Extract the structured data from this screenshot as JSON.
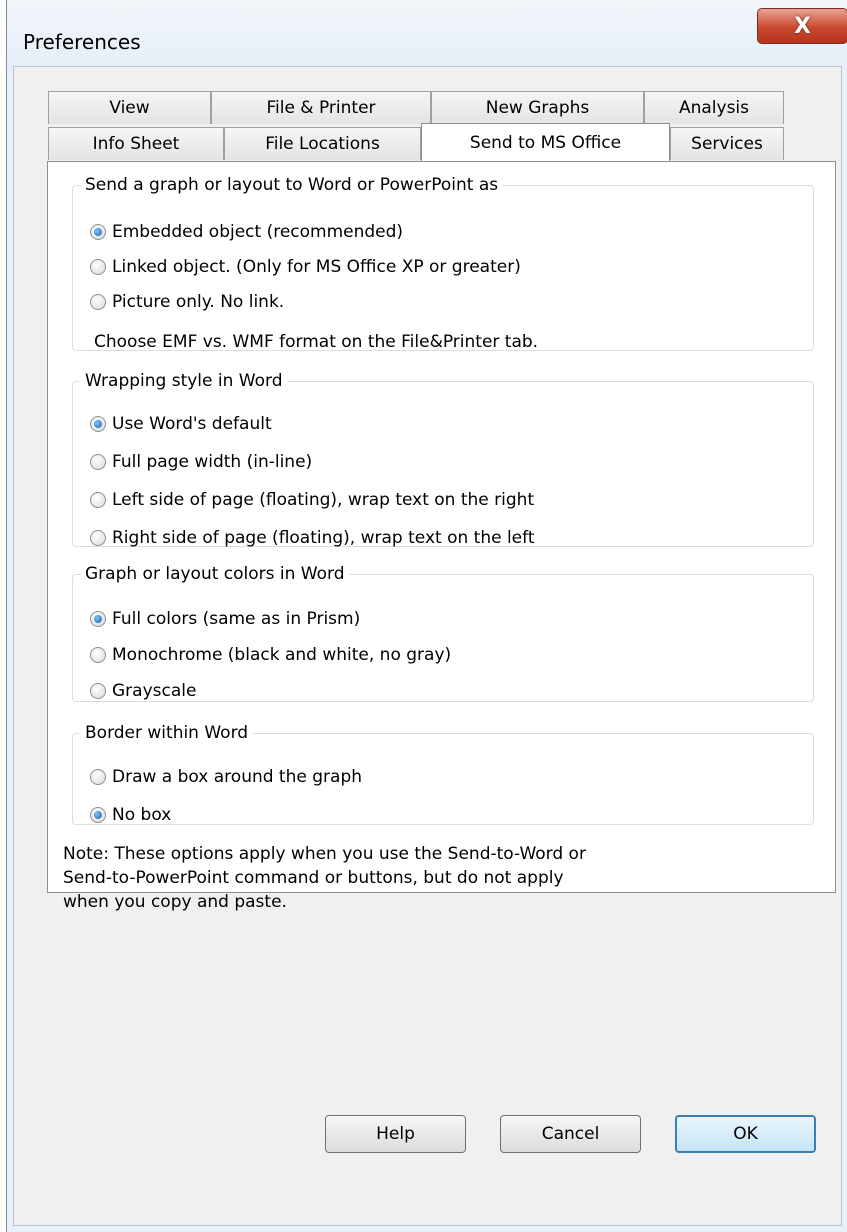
{
  "window": {
    "title": "Preferences",
    "close_glyph": "X"
  },
  "tabs": {
    "row1": [
      "View",
      "File & Printer",
      "New Graphs",
      "Analysis"
    ],
    "row2": [
      "Info Sheet",
      "File Locations",
      "Send to MS Office",
      "Services"
    ],
    "active": "Send to MS Office"
  },
  "send_as": {
    "legend": "Send a graph or layout to Word or PowerPoint as",
    "options": [
      {
        "label": "Embedded object (recommended)",
        "checked": true
      },
      {
        "label": "Linked object. (Only for MS Office XP or greater)",
        "checked": false
      },
      {
        "label": "Picture only. No link.",
        "checked": false
      }
    ],
    "hint": "Choose EMF vs. WMF format on the File&Printer tab."
  },
  "wrapping": {
    "legend": "Wrapping style in Word",
    "options": [
      {
        "label": "Use Word's default",
        "checked": true
      },
      {
        "label": "Full page width (in-line)",
        "checked": false
      },
      {
        "label": "Left side of page (floating), wrap text on the right",
        "checked": false
      },
      {
        "label": "Right side of page (floating), wrap text on the left",
        "checked": false
      }
    ]
  },
  "colors": {
    "legend": "Graph or layout colors in Word",
    "options": [
      {
        "label": "Full colors (same as in Prism)",
        "checked": true
      },
      {
        "label": "Monochrome (black and white, no gray)",
        "checked": false
      },
      {
        "label": "Grayscale",
        "checked": false
      }
    ]
  },
  "border": {
    "legend": "Border within Word",
    "options": [
      {
        "label": "Draw a box around the graph",
        "checked": false
      },
      {
        "label": "No box",
        "checked": true
      }
    ]
  },
  "note": "Note: These options apply when you use  the Send-to-Word or\nSend-to-PowerPoint command or buttons, but do not apply\nwhen you copy and paste.",
  "buttons": {
    "help": "Help",
    "cancel": "Cancel",
    "ok": "OK"
  },
  "colors_theme": {
    "accent": "#3c7fb1",
    "close_red": "#c9492f",
    "radio_selected": "#1a5fb4"
  }
}
